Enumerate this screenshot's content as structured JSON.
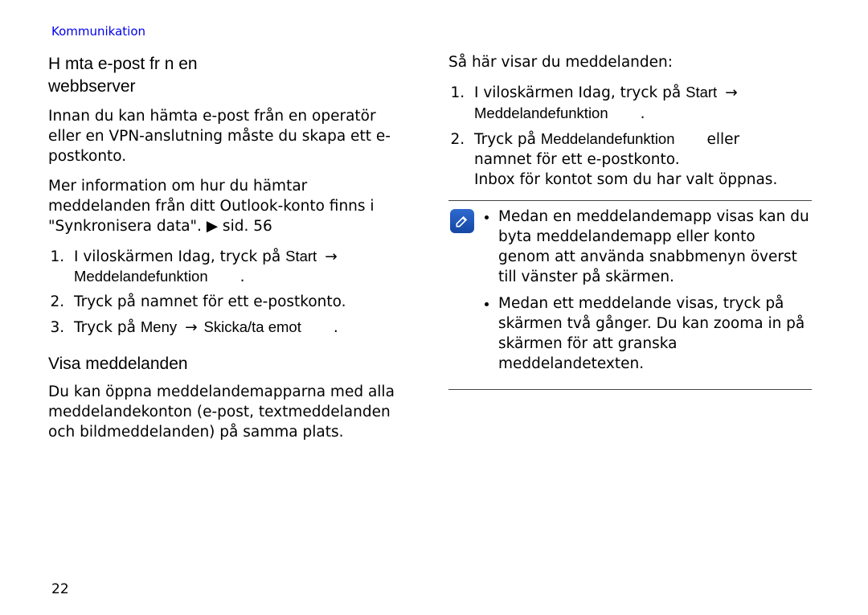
{
  "section_header": "Kommunikation",
  "page_number": "22",
  "left": {
    "heading_l1": "H mta e-post fr n en",
    "heading_l2": "webbserver",
    "p1": "Innan du kan hämta e-post från en operatör eller en VPN-anslutning måste du skapa ett e-postkonto.",
    "p2a": "Mer information om hur du hämtar meddelanden från ditt Outlook-konto finns i \"Synkronisera data\". ",
    "p2_tri": "▶",
    "p2b": " sid. 56",
    "ol": {
      "i1a": "I viloskärmen Idag, tryck på ",
      "i1_start": "Start",
      "i1_arrow": "→",
      "i1_mf": "Meddelandefunktion",
      "i1_dot": ".",
      "i2": "Tryck på namnet för ett e-postkonto.",
      "i3a": "Tryck på ",
      "i3_meny": "Meny",
      "i3_arrow": "→",
      "i3_skicka": "Skicka/ta emot",
      "i3_dot": "."
    },
    "visa_heading": "Visa meddelanden",
    "visa_p": "Du kan öppna meddelandemapparna med alla meddelandekonton (e-post, textmeddelanden och bildmeddelanden) på samma plats."
  },
  "right": {
    "intro": "Så här visar du meddelanden:",
    "ol": {
      "i1a": "I viloskärmen Idag, tryck på ",
      "i1_start": "Start",
      "i1_arrow": "→",
      "i1_mf": "Meddelandefunktion",
      "i1_dot": ".",
      "i2a": "Tryck på ",
      "i2_mf": "Meddelandefunktion",
      "i2_eller": "eller",
      "i2b": "namnet för ett e-postkonto.",
      "i2c": "Inbox för kontot som du har valt öppnas."
    },
    "note": {
      "b1": "Medan en meddelandemapp visas kan du byta meddelandemapp eller konto genom att använda snabbmenyn överst till vänster på skärmen.",
      "b2": "Medan ett meddelande visas, tryck på skärmen två gånger. Du kan zooma in på skärmen för att granska meddelandetexten."
    }
  }
}
